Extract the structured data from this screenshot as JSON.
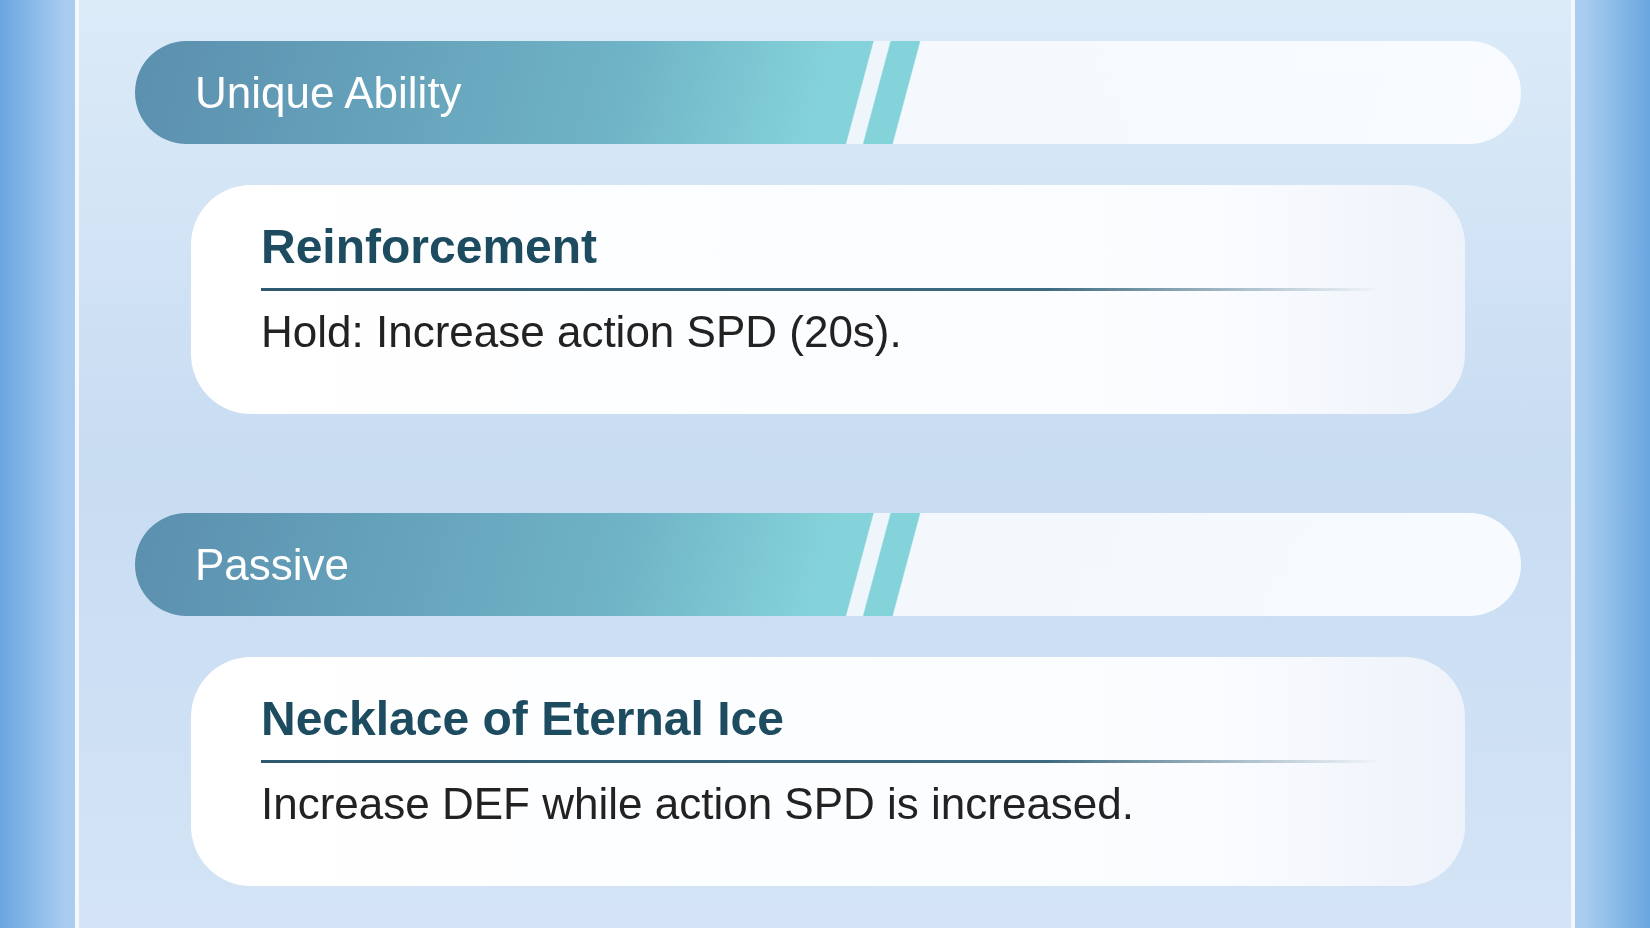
{
  "sections": [
    {
      "header": "Unique Ability",
      "title": "Reinforcement",
      "description": "Hold: Increase action SPD (20s)."
    },
    {
      "header": "Passive",
      "title": "Necklace of Eternal Ice",
      "description": "Increase DEF while action SPD is increased."
    }
  ]
}
